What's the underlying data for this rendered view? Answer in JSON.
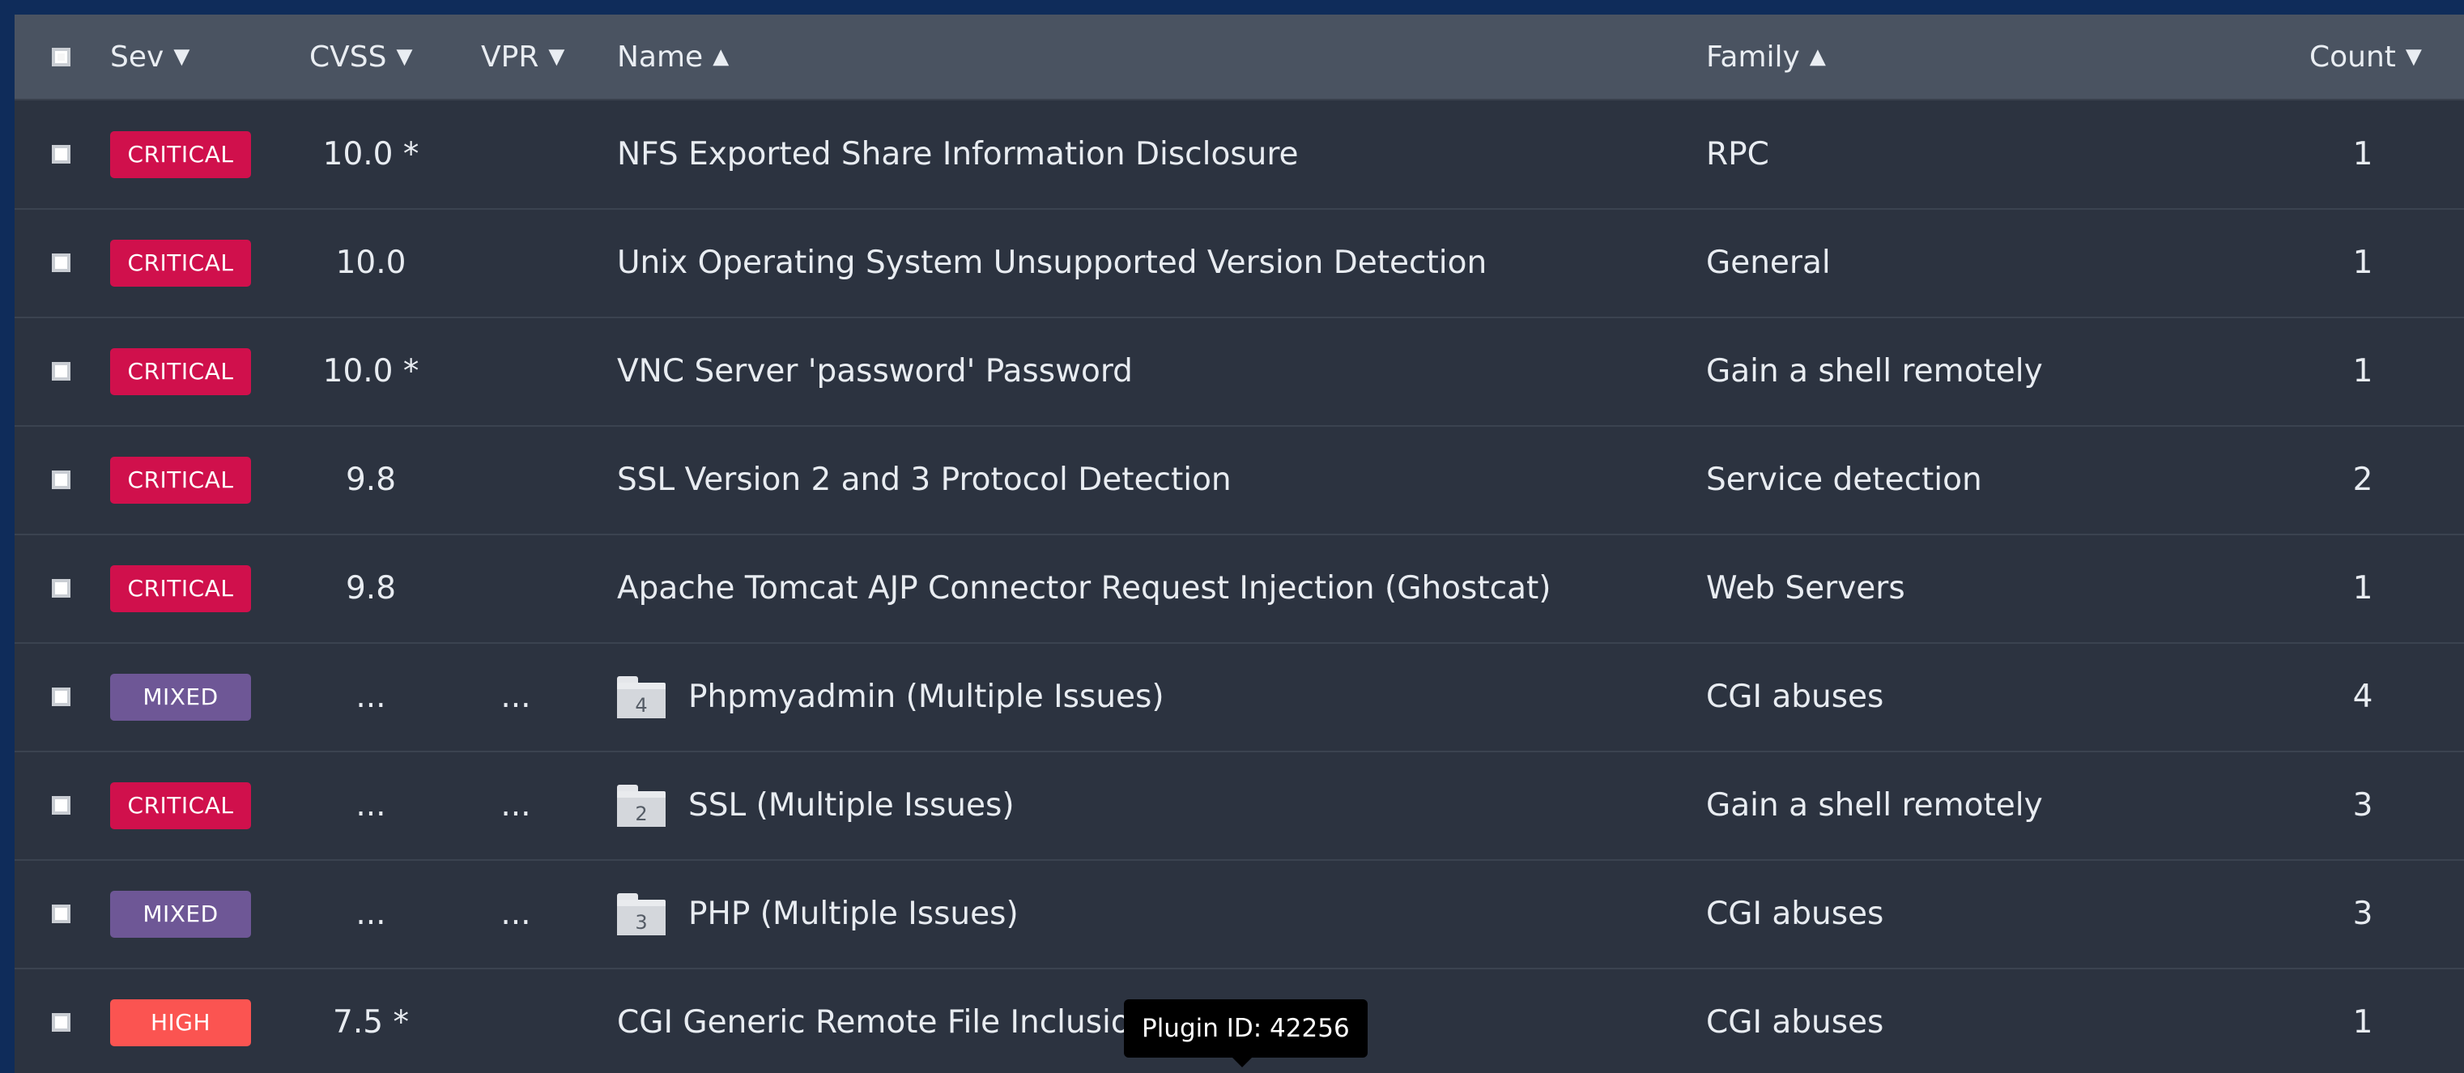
{
  "header": {
    "columns": {
      "sev": "Sev",
      "cvss": "CVSS",
      "vpr": "VPR",
      "name": "Name",
      "family": "Family",
      "count": "Count"
    },
    "arrows": {
      "down": "▼",
      "up": "▲"
    }
  },
  "colors": {
    "critical": "#d0104c",
    "mixed": "#6e5796",
    "high": "#fb5451"
  },
  "rows": [
    {
      "severity": "CRITICAL",
      "cvss": "10.0 *",
      "vpr": "",
      "name": "NFS Exported Share Information Disclosure",
      "family": "RPC",
      "count": "1"
    },
    {
      "severity": "CRITICAL",
      "cvss": "10.0",
      "vpr": "",
      "name": "Unix Operating System Unsupported Version Detection",
      "family": "General",
      "count": "1"
    },
    {
      "severity": "CRITICAL",
      "cvss": "10.0 *",
      "vpr": "",
      "name": "VNC Server 'password' Password",
      "family": "Gain a shell remotely",
      "count": "1"
    },
    {
      "severity": "CRITICAL",
      "cvss": "9.8",
      "vpr": "",
      "name": "SSL Version 2 and 3 Protocol Detection",
      "family": "Service detection",
      "count": "2"
    },
    {
      "severity": "CRITICAL",
      "cvss": "9.8",
      "vpr": "",
      "name": "Apache Tomcat AJP Connector Request Injection (Ghostcat)",
      "family": "Web Servers",
      "count": "1"
    },
    {
      "severity": "MIXED",
      "cvss": "...",
      "vpr": "...",
      "group_count": "4",
      "name": "Phpmyadmin (Multiple Issues)",
      "family": "CGI abuses",
      "count": "4"
    },
    {
      "severity": "CRITICAL",
      "cvss": "...",
      "vpr": "...",
      "group_count": "2",
      "name": "SSL (Multiple Issues)",
      "family": "Gain a shell remotely",
      "count": "3"
    },
    {
      "severity": "MIXED",
      "cvss": "...",
      "vpr": "...",
      "group_count": "3",
      "name": "PHP (Multiple Issues)",
      "family": "CGI abuses",
      "count": "3"
    },
    {
      "severity": "HIGH",
      "cvss": "7.5 *",
      "vpr": "",
      "name": "CGI Generic Remote File Inclusion",
      "family": "CGI abuses",
      "count": "1"
    }
  ],
  "tooltip": {
    "text": "Plugin ID: 42256"
  }
}
